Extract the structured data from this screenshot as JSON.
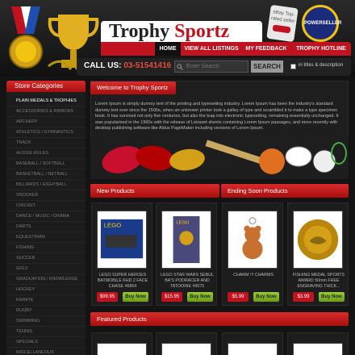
{
  "header": {
    "title_main": "Trophy",
    "title_accent": "Sportz",
    "ebay_badge": "eBay Top-rated seller",
    "power_badge": "POWERSELLER",
    "call_label": "CALL US:",
    "phone": "03-51541416",
    "nav": [
      "HOME",
      "VIEW ALL LISTINGS",
      "MY FEEDBACK",
      "TROPHY HOTLINE"
    ],
    "search": {
      "placeholder": "Enter Search",
      "button": "SEARCH",
      "checkbox_label": "in titles & description"
    }
  },
  "sidebar": {
    "title": "Store Categories",
    "items": [
      "PLAIN MEDALS & TROPHIES",
      "ACCESSORIES & RIBBONS",
      "ARCHERY",
      "ATHLETICS / GYMNASTICS",
      "TRACK",
      "AUSSIE RULES",
      "BASEBALL / SOFTBALL",
      "BASKETBALL / NETBALL",
      "BILLIARDS / EIGHTBALL",
      "SNOOKER",
      "CRICKET",
      "DANCE / MUSIC / DRAMA",
      "DARTS",
      "EQUESTRIAN",
      "FISHING",
      "SOCCER",
      "GOLF",
      "GRADUATION / KNOWLEDGE",
      "HOCKEY",
      "KARATE",
      "RUGBY",
      "SWIMMING",
      "TENNIS",
      "SPECIALS",
      "MISCELLANEOUS"
    ]
  },
  "welcome": {
    "title": "Welcome to Trophy Sportz",
    "text": "Lorem Ipsum is simply dummy text of the printing and typesetting industry. Lorem Ipsum has been the industry's standard dummy text ever since the 1500s, when an unknown printer took a galley of type and scrambled it to make a type specimen book. It has survived not only five centuries, but also the leap into electronic typesetting, remaining essentially unchanged. It was popularised in the 1960s with the release of Letraset sheets containing Lorem Ipsum passages, and more recently with desktop publishing software like Aldus PageMaker including versions of Lorem Ipsum."
  },
  "new_products": {
    "title": "New Products",
    "items": [
      {
        "name": "LEGO SUPER HEROES BATMOBILE KHD 2 FACE CHASE #6864",
        "price": "$99.95",
        "buy": "Buy Now"
      },
      {
        "name": "LEGO STAR WARS SEBUL BA'S PODRACER AND TATOOINE #9675",
        "price": "$15.95",
        "buy": "Buy Now"
      }
    ]
  },
  "ending_soon": {
    "title": "Ending Soon Products",
    "items": [
      {
        "name": "CHARM !!! CHARMS",
        "price": "$5.99",
        "buy": "Buy Now"
      },
      {
        "name": "FISHING MEDAL SPORTS AWARD 50mm FREE ENGRAVING THICK...",
        "price": "$3.99",
        "buy": "Buy Now"
      }
    ]
  },
  "featured": {
    "title": "Featured Products"
  },
  "colors": {
    "accent": "#c1121f",
    "buy": "#8bc34a",
    "background": "#141414"
  }
}
